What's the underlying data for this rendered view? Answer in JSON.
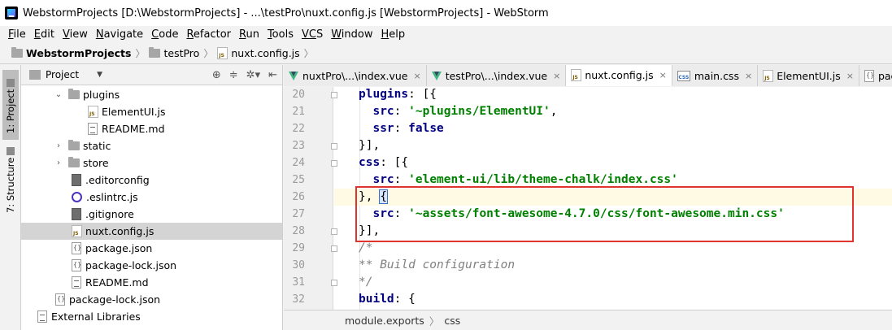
{
  "window": {
    "title": "WebstormProjects [D:\\WebstormProjects] - ...\\testPro\\nuxt.config.js [WebstormProjects] - WebStorm"
  },
  "menu": [
    {
      "mnemonic": "F",
      "rest": "ile"
    },
    {
      "mnemonic": "E",
      "rest": "dit"
    },
    {
      "mnemonic": "V",
      "rest": "iew"
    },
    {
      "mnemonic": "N",
      "rest": "avigate"
    },
    {
      "mnemonic": "C",
      "rest": "ode"
    },
    {
      "mnemonic": "R",
      "rest": "efactor"
    },
    {
      "mnemonic": "R",
      "rest": "un"
    },
    {
      "mnemonic": "T",
      "rest": "ools"
    },
    {
      "mnemonic": "VC",
      "rest": "S"
    },
    {
      "mnemonic": "W",
      "rest": "indow"
    },
    {
      "mnemonic": "H",
      "rest": "elp"
    }
  ],
  "breadcrumb": [
    "WebstormProjects",
    "testPro",
    "nuxt.config.js"
  ],
  "left_strip": {
    "project_tab": "1: Project",
    "structure_tab": "7: Structure"
  },
  "project_panel": {
    "title": "Project",
    "tree": [
      {
        "label": "plugins",
        "type": "folder",
        "expanded": true
      },
      {
        "label": "ElementUI.js",
        "type": "js"
      },
      {
        "label": "README.md",
        "type": "md"
      },
      {
        "label": "static",
        "type": "folder",
        "expanded": false
      },
      {
        "label": "store",
        "type": "folder",
        "expanded": false
      },
      {
        "label": ".editorconfig",
        "type": "config"
      },
      {
        "label": ".eslintrc.js",
        "type": "eslint"
      },
      {
        "label": ".gitignore",
        "type": "text"
      },
      {
        "label": "nuxt.config.js",
        "type": "js",
        "selected": true
      },
      {
        "label": "package.json",
        "type": "json"
      },
      {
        "label": "package-lock.json",
        "type": "json"
      },
      {
        "label": "README.md",
        "type": "md"
      },
      {
        "label": "package-lock.json",
        "type": "json"
      },
      {
        "label": "External Libraries",
        "type": "lib"
      }
    ]
  },
  "tabs": [
    {
      "label": "nuxtPro\\...\\index.vue",
      "type": "vue"
    },
    {
      "label": "testPro\\...\\index.vue",
      "type": "vue"
    },
    {
      "label": "nuxt.config.js",
      "type": "js",
      "active": true
    },
    {
      "label": "main.css",
      "type": "css"
    },
    {
      "label": "ElementUI.js",
      "type": "js"
    },
    {
      "label": "packag",
      "type": "json"
    }
  ],
  "editor": {
    "line_numbers": [
      "20",
      "21",
      "22",
      "23",
      "24",
      "25",
      "26",
      "27",
      "28",
      "29",
      "30",
      "31",
      "32"
    ],
    "lines": [
      {
        "key": "plugins",
        "p1": ": [{"
      },
      {
        "key": "src",
        "str": "'~plugins/ElementUI'",
        "p1": ","
      },
      {
        "key": "ssr",
        "bool": "false"
      },
      {
        "p0": "}],"
      },
      {
        "key": "css",
        "p1": ": [{"
      },
      {
        "key": "src",
        "str": "'element-ui/lib/theme-chalk/index.css'"
      },
      {
        "p0": "}, {"
      },
      {
        "key": "src",
        "str": "'~assets/font-awesome-4.7.0/css/font-awesome.min.css'"
      },
      {
        "p0": "}],"
      },
      {
        "comment": "/*"
      },
      {
        "comment": "** Build configuration"
      },
      {
        "comment": "*/"
      },
      {
        "key": "build",
        "p1": ": {"
      }
    ]
  },
  "status": {
    "path": [
      "module.exports",
      "css"
    ]
  }
}
